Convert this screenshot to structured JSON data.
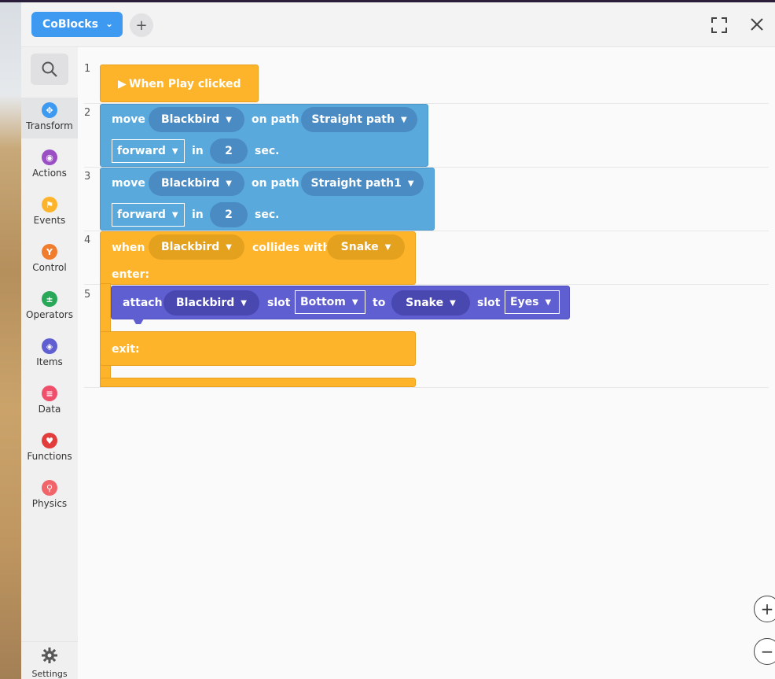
{
  "header": {
    "app_name": "CoBlocks",
    "add_symbol": "+",
    "fullscreen_icon": "expand-icon",
    "close_icon": "close-icon"
  },
  "sidebar": {
    "search_icon": "search-icon",
    "categories": [
      {
        "label": "Transform",
        "color": "#3d9af0",
        "icon": "move-icon"
      },
      {
        "label": "Actions",
        "color": "#9b4fc5",
        "icon": "eye-icon"
      },
      {
        "label": "Events",
        "color": "#fdb42b",
        "icon": "flag-icon"
      },
      {
        "label": "Control",
        "color": "#f07d2e",
        "icon": "branch-icon"
      },
      {
        "label": "Operators",
        "color": "#2aa85a",
        "icon": "plus-minus-icon"
      },
      {
        "label": "Items",
        "color": "#5f5fd2",
        "icon": "cube-icon"
      },
      {
        "label": "Data",
        "color": "#ef4f6a",
        "icon": "list-icon"
      },
      {
        "label": "Functions",
        "color": "#e23c3c",
        "icon": "heart-icon"
      },
      {
        "label": "Physics",
        "color": "#f0646a",
        "icon": "physics-icon"
      }
    ],
    "settings_label": "Settings"
  },
  "lines": [
    "1",
    "2",
    "3",
    "4",
    "5"
  ],
  "blocks": {
    "event": {
      "label": "When Play clicked"
    },
    "move1": {
      "move": "move",
      "object": "Blackbird",
      "on_path": "on path",
      "path": "Straight path",
      "direction": "forward",
      "in": "in",
      "duration": "2",
      "sec": "sec."
    },
    "move2": {
      "move": "move",
      "object": "Blackbird",
      "on_path": "on path",
      "path": "Straight path1",
      "direction": "forward",
      "in": "in",
      "duration": "2",
      "sec": "sec."
    },
    "collide": {
      "when": "when",
      "object": "Blackbird",
      "collides_with": "collides with",
      "target": "Snake",
      "enter": "enter:",
      "exit": "exit:"
    },
    "attach": {
      "attach": "attach",
      "object": "Blackbird",
      "slot1": "slot",
      "slot1_value": "Bottom",
      "to": "to",
      "target": "Snake",
      "slot2": "slot",
      "slot2_value": "Eyes"
    }
  },
  "zoom": {
    "in": "+",
    "out": "−"
  }
}
